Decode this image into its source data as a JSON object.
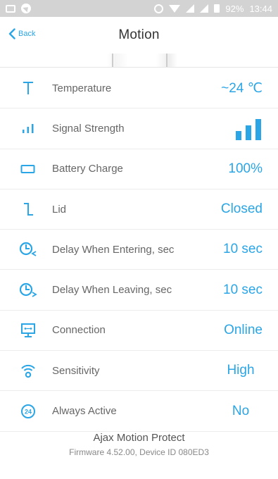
{
  "status_bar": {
    "battery_percent": "92%",
    "time": "13:44"
  },
  "header": {
    "back_label": "Back",
    "title": "Motion"
  },
  "rows": [
    {
      "icon": "temperature-icon",
      "label": "Temperature",
      "value": "~24 ℃"
    },
    {
      "icon": "signal-icon",
      "label": "Signal Strength",
      "value": ""
    },
    {
      "icon": "battery-icon",
      "label": "Battery Charge",
      "value": "100%"
    },
    {
      "icon": "lid-icon",
      "label": "Lid",
      "value": "Closed"
    },
    {
      "icon": "delay-entering-icon",
      "label": "Delay When Entering, sec",
      "value": "10 sec"
    },
    {
      "icon": "delay-leaving-icon",
      "label": "Delay When Leaving, sec",
      "value": "10 sec"
    },
    {
      "icon": "connection-icon",
      "label": "Connection",
      "value": "Online"
    },
    {
      "icon": "sensitivity-icon",
      "label": "Sensitivity",
      "value": "High"
    },
    {
      "icon": "always-active-icon",
      "label": "Always Active",
      "value": "No"
    }
  ],
  "footer": {
    "device_name": "Ajax Motion Protect",
    "device_info": "Firmware 4.52.00, Device ID 080ED3"
  },
  "colors": {
    "accent": "#2aa5e6",
    "status_bar": "#d3d3d3"
  }
}
